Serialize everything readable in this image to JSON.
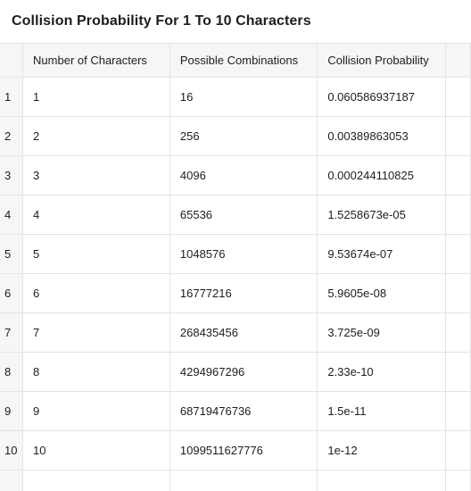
{
  "title": "Collision Probability For 1 To 10 Characters",
  "columns": [
    "Number of Characters",
    "Possible Combinations",
    "Collision Probability"
  ],
  "rows": [
    {
      "index": "1",
      "characters": "1",
      "combinations": "16",
      "probability": "0.060586937187"
    },
    {
      "index": "2",
      "characters": "2",
      "combinations": "256",
      "probability": "0.00389863053"
    },
    {
      "index": "3",
      "characters": "3",
      "combinations": "4096",
      "probability": "0.000244110825"
    },
    {
      "index": "4",
      "characters": "4",
      "combinations": "65536",
      "probability": "1.5258673e-05"
    },
    {
      "index": "5",
      "characters": "5",
      "combinations": "1048576",
      "probability": "9.53674e-07"
    },
    {
      "index": "6",
      "characters": "6",
      "combinations": "16777216",
      "probability": "5.9605e-08"
    },
    {
      "index": "7",
      "characters": "7",
      "combinations": "268435456",
      "probability": "3.725e-09"
    },
    {
      "index": "8",
      "characters": "8",
      "combinations": "4294967296",
      "probability": "2.33e-10"
    },
    {
      "index": "9",
      "characters": "9",
      "combinations": "68719476736",
      "probability": "1.5e-11"
    },
    {
      "index": "10",
      "characters": "10",
      "combinations": "1099511627776",
      "probability": "1e-12"
    }
  ]
}
